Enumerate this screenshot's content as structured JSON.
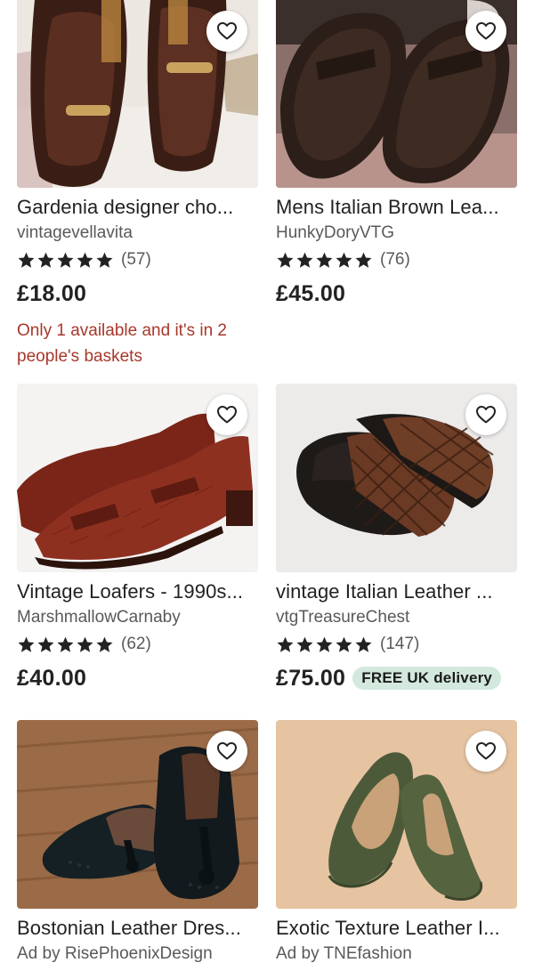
{
  "listings": [
    {
      "title": "Gardenia designer cho...",
      "shop": "vintagevellavita",
      "rating_count": "(57)",
      "stars": 5,
      "price": "£18.00",
      "scarcity": "Only 1 available and it's in 2 people's baskets",
      "image_subject": "brown patent loafers with gold horsebit"
    },
    {
      "title": "Mens Italian Brown Lea...",
      "shop": "HunkyDoryVTG",
      "rating_count": "(76)",
      "stars": 5,
      "price": "£45.00",
      "image_subject": "dark brown leather penny loafers"
    },
    {
      "title": "Vintage Loafers - 1990s...",
      "shop": "MarshmallowCarnaby",
      "rating_count": "(62)",
      "stars": 5,
      "price": "£40.00",
      "image_subject": "red croc-embossed heeled loafers"
    },
    {
      "title": "vintage Italian Leather ...",
      "shop": "vtgTreasureChest",
      "rating_count": "(147)",
      "stars": 5,
      "price": "£75.00",
      "badge": "FREE UK delivery",
      "image_subject": "woven leather mule slippers"
    },
    {
      "title": "Bostonian Leather Dres...",
      "ad_label": "Ad by RisePhoenixDesign",
      "image_subject": "black tasselled wingtip loafers"
    },
    {
      "title": "Exotic Texture Leather I...",
      "ad_label": "Ad by TNEfashion",
      "image_subject": "green suede loafers"
    }
  ],
  "colors": {
    "star": "#222222",
    "scarcity": "#a8382a",
    "badge_bg": "#d4e9dd",
    "secondary_text": "#595959"
  },
  "icons": {
    "favorite": "heart-outline-icon",
    "rating": "star-icon"
  }
}
